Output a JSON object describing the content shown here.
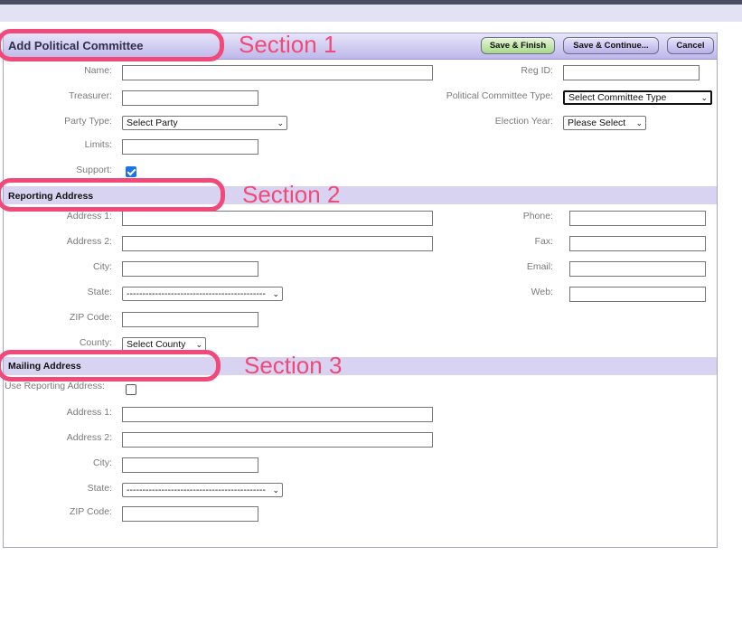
{
  "page": {
    "title": "Add Political Committee",
    "buttons": {
      "save_finish": "Save & Finish",
      "save_continue": "Save & Continue...",
      "cancel": "Cancel"
    }
  },
  "section1": {
    "name_label": "Name:",
    "treasurer_label": "Treasurer:",
    "party_type_label": "Party Type:",
    "party_type_value": "Select Party",
    "limits_label": "Limits:",
    "support_label": "Support:",
    "support_checked": true,
    "reg_id_label": "Reg ID:",
    "committee_type_label": "Political Committee Type:",
    "committee_type_value": "Select Committee Type",
    "election_year_label": "Election Year:",
    "election_year_value": "Please Select"
  },
  "reporting": {
    "title": "Reporting Address",
    "address1_label": "Address 1:",
    "address2_label": "Address 2:",
    "city_label": "City:",
    "state_label": "State:",
    "state_value": "--------------------------------------------",
    "zip_label": "ZIP Code:",
    "county_label": "County:",
    "county_value": "Select County",
    "phone_label": "Phone:",
    "fax_label": "Fax:",
    "email_label": "Email:",
    "web_label": "Web:"
  },
  "mailing": {
    "title": "Mailing Address",
    "use_reporting_label": "Use Reporting Address:",
    "use_reporting_checked": false,
    "address1_label": "Address 1:",
    "address2_label": "Address 2:",
    "city_label": "City:",
    "state_label": "State:",
    "state_value": "--------------------------------------------",
    "zip_label": "ZIP Code:"
  },
  "annotations": {
    "section1": "Section 1",
    "section2": "Section 2",
    "section3": "Section 3"
  },
  "colors": {
    "annotation": "#f0497a",
    "header": "#bdb8ea",
    "section_bar": "#d7d3f0",
    "checkbox": "#1a73e8"
  }
}
